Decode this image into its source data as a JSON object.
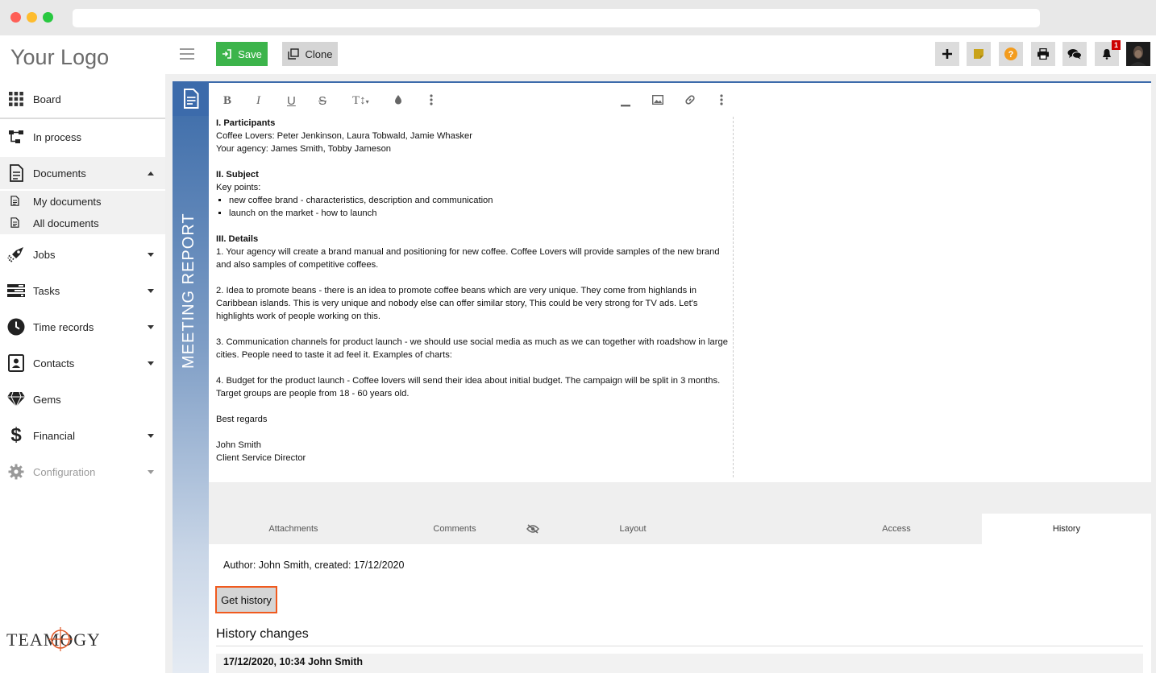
{
  "sidebar": {
    "logo": "Your Logo",
    "items": [
      {
        "label": "Board",
        "icon": "grid-icon"
      },
      {
        "label": "In process",
        "icon": "flow-icon"
      },
      {
        "label": "Documents",
        "icon": "document-icon"
      },
      {
        "label": "Jobs",
        "icon": "rocket-icon"
      },
      {
        "label": "Tasks",
        "icon": "tasks-icon"
      },
      {
        "label": "Time records",
        "icon": "clock-icon"
      },
      {
        "label": "Contacts",
        "icon": "contact-card-icon"
      },
      {
        "label": "Gems",
        "icon": "diamond-icon"
      },
      {
        "label": "Financial",
        "icon": "dollar-icon"
      },
      {
        "label": "Configuration",
        "icon": "gear-icon"
      }
    ],
    "sub_items": [
      {
        "label": "My documents",
        "icon": "document-small-icon"
      },
      {
        "label": "All documents",
        "icon": "document-small-icon"
      }
    ],
    "brand": "TEAMOGY"
  },
  "toolbar": {
    "save_label": "Save",
    "clone_label": "Clone",
    "notification_count": "1"
  },
  "document": {
    "vertical_title": "MEETING REPORT",
    "sections": {
      "s1_title": "I. Participants",
      "s1_line1": "Coffee Lovers: Peter Jenkinson, Laura Tobwald, Jamie Whasker",
      "s1_line2": "Your agency: James Smith, Tobby Jameson",
      "s2_title": "II. Subject",
      "s2_line1": "Key points:",
      "s2_bullet1": "new coffee brand - characteristics, description and communication",
      "s2_bullet2": "launch on the market - how to launch",
      "s3_title": "III. Details",
      "p1": "1. Your agency will create a brand manual and positioning for new coffee.  Coffee Lovers will provide samples of the new brand and also samples of competitive coffees.",
      "p2": "2. Idea to promote beans - there is an idea to promote coffee beans which are very unique. They come from highlands in Caribbean islands. This is very unique and nobody else can offer similar story, This could be very strong for TV ads. Let's highlights work of people working on this.",
      "p3": "3. Communication channels for product launch - we should use social media as much as we can together with roadshow in large cities. People need to taste it ad feel it. Examples of charts:",
      "p4": "4. Budget for the product launch - Coffee lovers will send their idea about initial budget. The campaign will be split in 3 months. Target groups are people from 18 - 60 years old.",
      "closing": "Best regards",
      "signature_name": "John Smith",
      "signature_title": "Client Service Director"
    }
  },
  "tabs": [
    "Attachments",
    "Comments",
    "Layout",
    "Access",
    "History"
  ],
  "history": {
    "author_line": "Author: John Smith, created: 17/12/2020",
    "button_label": "Get history",
    "title": "History changes",
    "entry": "17/12/2020, 10:34 John Smith"
  },
  "colors": {
    "save_green": "#3cb44b",
    "accent_blue": "#3c6bab",
    "highlight_orange": "#f05a1e",
    "notification_red": "#cc0000"
  }
}
